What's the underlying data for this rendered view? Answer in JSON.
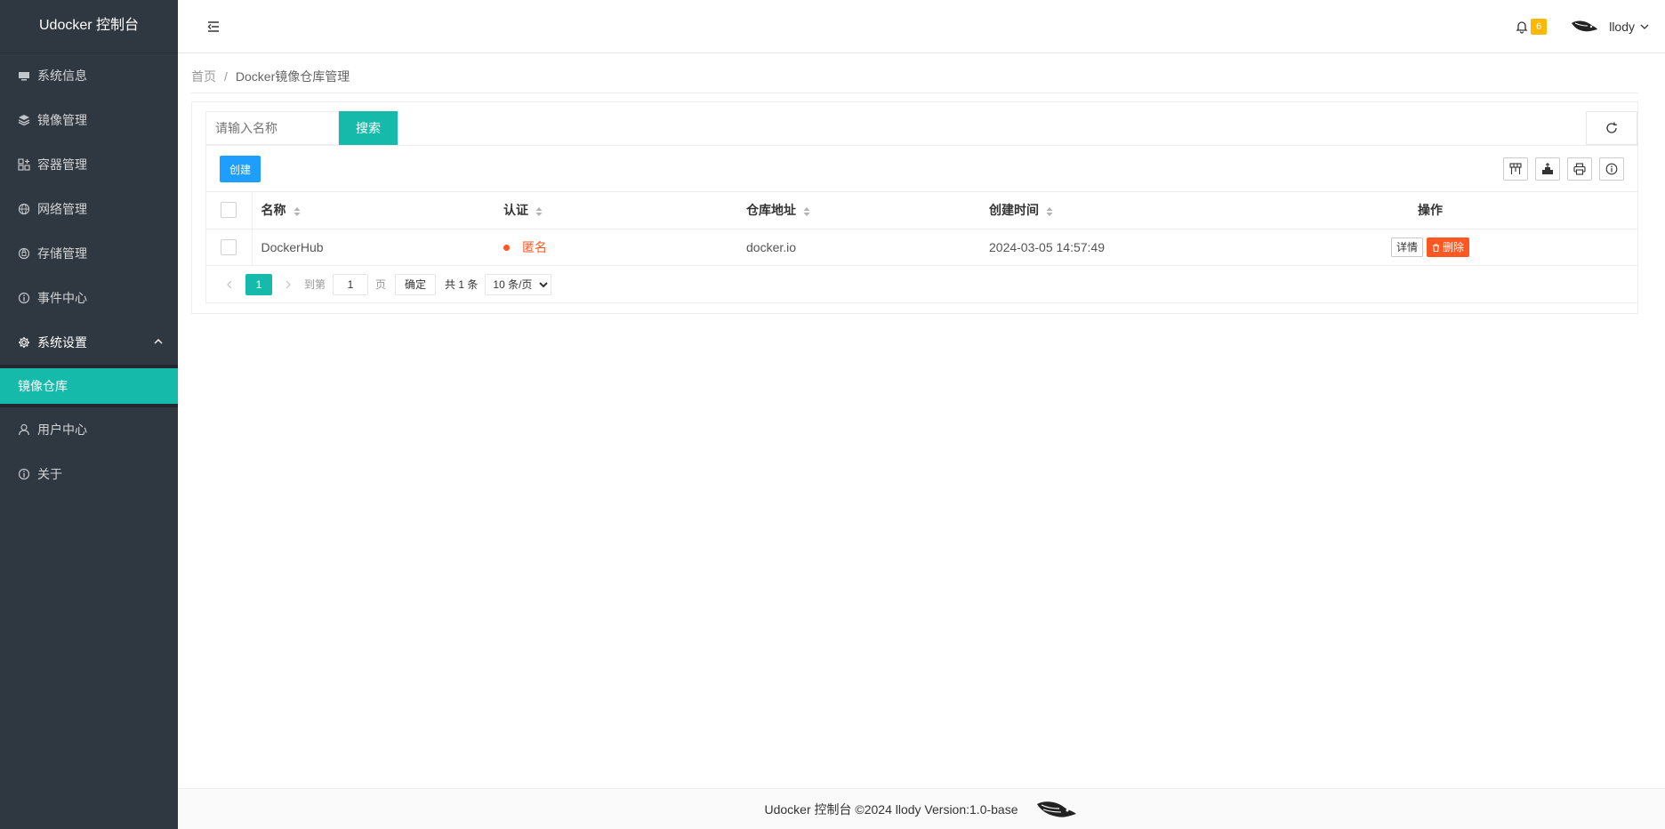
{
  "app": {
    "title": "Udocker 控制台"
  },
  "sidebar": {
    "items": [
      {
        "label": "系统信息",
        "icon": "monitor-icon"
      },
      {
        "label": "镜像管理",
        "icon": "layers-icon"
      },
      {
        "label": "容器管理",
        "icon": "grid-add-icon"
      },
      {
        "label": "网络管理",
        "icon": "globe-icon"
      },
      {
        "label": "存储管理",
        "icon": "storage-icon"
      },
      {
        "label": "事件中心",
        "icon": "info-icon"
      },
      {
        "label": "系统设置",
        "icon": "gear-icon",
        "expanded": true,
        "children": [
          {
            "label": "镜像仓库",
            "active": true
          }
        ]
      },
      {
        "label": "用户中心",
        "icon": "user-icon"
      },
      {
        "label": "关于",
        "icon": "info-icon"
      }
    ]
  },
  "header": {
    "notifications": "6",
    "username": "llody"
  },
  "breadcrumb": {
    "home": "首页",
    "separator": "/",
    "current": "Docker镜像仓库管理"
  },
  "search": {
    "placeholder": "请输入名称",
    "button": "搜索"
  },
  "toolbar": {
    "create": "创建"
  },
  "table": {
    "columns": [
      "名称",
      "认证",
      "仓库地址",
      "创建时间",
      "操作"
    ],
    "rows": [
      {
        "name": "DockerHub",
        "auth": "匿名",
        "address": "docker.io",
        "created": "2024-03-05 14:57:49",
        "actions": {
          "detail": "详情",
          "delete": "删除"
        }
      }
    ]
  },
  "pagination": {
    "current": "1",
    "goto_label": "到第",
    "page_value": "1",
    "page_unit": "页",
    "confirm": "确定",
    "total": "共 1 条",
    "page_size": "10 条/页"
  },
  "footer": {
    "text": "Udocker 控制台 ©2024 llody Version:1.0-base"
  },
  "colors": {
    "sidebar_bg": "#2f3740",
    "accent": "#16baaa",
    "primary": "#1e9fff",
    "danger": "#ff5722",
    "badge": "#ffb800"
  }
}
